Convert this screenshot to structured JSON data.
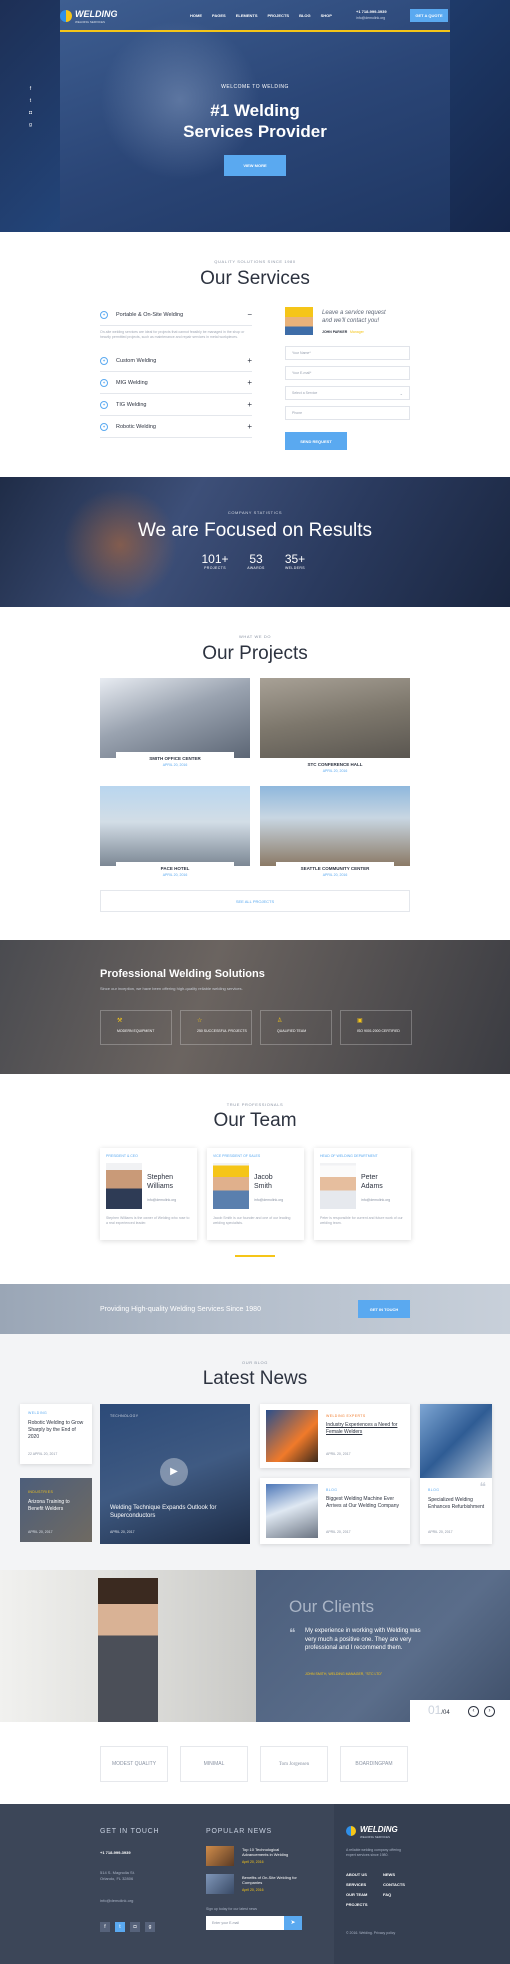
{
  "header": {
    "brand": "WELDING",
    "tagline": "WELDING SERVICES",
    "nav": [
      "HOME",
      "PAGES",
      "ELEMENTS",
      "PROJECTS",
      "BLOG",
      "SHOP"
    ],
    "phone": "+1 718-999-3939",
    "email": "info@demolink.org",
    "cta": "GET A QUOTE"
  },
  "hero": {
    "kicker": "WELCOME TO WELDING",
    "title_line1": "#1 Welding",
    "title_line2": "Services Provider",
    "button": "VIEW MORE"
  },
  "services": {
    "kicker": "QUALITY SOLUTIONS SINCE 1980",
    "title": "Our Services",
    "items": [
      {
        "label": "Portable & On-Site Welding",
        "toggle": "−"
      },
      {
        "label": "Custom Welding",
        "toggle": "+"
      },
      {
        "label": "MIG Welding",
        "toggle": "+"
      },
      {
        "label": "TIG Welding",
        "toggle": "+"
      },
      {
        "label": "Robotic Welding",
        "toggle": "+"
      }
    ],
    "open_text": "On-site welding services are ideal for projects that cannot feasibly be managed in the shop or heavily permitted projects, such as maintenance and repair services in metal workpieces.",
    "request_line1": "Leave a service request",
    "request_line2": "and we'll contact you!",
    "request_person": "JOHN PARKER",
    "request_role": "Manager",
    "fields": [
      "Your Name*",
      "Your E-mail*",
      "Select a Service",
      "Phone"
    ],
    "button": "SEND REQUEST"
  },
  "stats": {
    "kicker": "COMPANY STATISTICS",
    "title": "We are Focused on Results",
    "items": [
      {
        "num": "101+",
        "label": "PROJECTS"
      },
      {
        "num": "53",
        "label": "AWARDS"
      },
      {
        "num": "35+",
        "label": "WELDERS"
      }
    ]
  },
  "projects": {
    "kicker": "WHAT WE DO",
    "title": "Our Projects",
    "items": [
      {
        "name": "SMITH OFFICE CENTER",
        "date": "APRIL 20, 2016"
      },
      {
        "name": "STC CONFERENCE HALL",
        "date": "APRIL 20, 2016"
      },
      {
        "name": "PACE HOTEL",
        "date": "APRIL 20, 2016"
      },
      {
        "name": "SEATTLE COMMUNITY CENTER",
        "date": "APRIL 20, 2016"
      }
    ],
    "button": "SEE ALL PROJECTS"
  },
  "solutions": {
    "title": "Professional Welding Solutions",
    "text": "Since our inception, we have been offering high-quality reliable welding services.",
    "features": [
      "MODERN EQUIPMENT",
      "250 SUCCESSFUL PROJECTS",
      "QUALIFIED TEAM",
      "ISO 9001:2000 CERTIFIED"
    ]
  },
  "team": {
    "kicker": "TRUE PROFESSIONALS",
    "title": "Our Team",
    "members": [
      {
        "role": "PRESIDENT & CEO",
        "name1": "Stephen",
        "name2": "Williams",
        "email": "info@demolink.org",
        "desc": "Stephen Williams is the owner of Welding who rose to a real experienced leader."
      },
      {
        "role": "VICE PRESIDENT OF SALES",
        "name1": "Jacob",
        "name2": "Smith",
        "email": "info@demolink.org",
        "desc": "Jacob Smith is our founder and one of our leading welding specialists."
      },
      {
        "role": "HEAD OF WELDING DEPARTMENT",
        "name1": "Peter",
        "name2": "Adams",
        "email": "info@demolink.org",
        "desc": "Peter is responsible for current and future work of our welding team."
      }
    ]
  },
  "banner": {
    "text": "Providing High-quality Welding Services Since 1980",
    "button": "GET IN TOUCH"
  },
  "news": {
    "kicker": "OUR BLOG",
    "title": "Latest News",
    "small_left": [
      {
        "tag": "WELDING",
        "title": "Robotic Welding to Grow Sharply by the End of 2020",
        "meta": "APRIL 20, 2017"
      },
      {
        "tag": "INDUSTRIES",
        "title": "Arizona Training to Benefit Welders",
        "meta": "APRIL 20, 2017"
      }
    ],
    "feature": {
      "tag": "TECHNOLOGY",
      "title": "Welding Technique Expands Outlook for Superconductors",
      "meta": "APRIL 20, 2017"
    },
    "right": [
      {
        "tag": "WELDING EXPERTS",
        "title": "Industry Experiences a Need for Female Welders",
        "meta": "APRIL 20, 2017"
      },
      {
        "tag": "BLOG",
        "title": "Biggest Welding Machine Ever Arrives at Our Welding Company",
        "meta": "APRIL 20, 2017"
      }
    ],
    "far_right": {
      "tag": "BLOG",
      "title": "Specialized Welding Enhances Refurbishment",
      "meta": "APRIL 20, 2017"
    },
    "comment_count": "22"
  },
  "clients": {
    "title": "Our Clients",
    "quote": "My experience in working with Welding was very much a positive one. They are very professional and I recommend them.",
    "author": "JOHN SMITH, WELDING MANAGER, \"STC LTD\"",
    "counter_current": "01",
    "counter_total": "/04"
  },
  "partners": [
    "MODEST QUALITY",
    "MINIMAL",
    "Tom Jorgensen",
    "BOARDINGPAM"
  ],
  "footer": {
    "contact_title": "GET IN TOUCH",
    "phone": "+1 718-999-3939",
    "address": "514 S. Magnolia St. Orlando, FL 32806",
    "email": "info@demolink.org",
    "news_title": "POPULAR NEWS",
    "news": [
      {
        "title": "Top 10 Technological Advancements in Welding",
        "date": "April 20, 2016"
      },
      {
        "title": "Benefits of On-Site Welding for Companies",
        "date": "April 20, 2016"
      }
    ],
    "newsletter_label": "Sign up today for our latest news",
    "newsletter_placeholder": "Enter your E-mail",
    "brand": "WELDING",
    "brand_sub": "WELDING SERVICES",
    "about": "A reliable welding company offering expert services since 1980.",
    "links": [
      "ABOUT US",
      "NEWS",
      "SERVICES",
      "CONTACTS",
      "OUR TEAM",
      "FAQ",
      "PROJECTS"
    ],
    "copyright": "© 2016. Welding. Privacy policy"
  },
  "colors": {
    "accent": "#5aa9f0",
    "dark": "#2d3340",
    "yellow": "#f5c518"
  }
}
